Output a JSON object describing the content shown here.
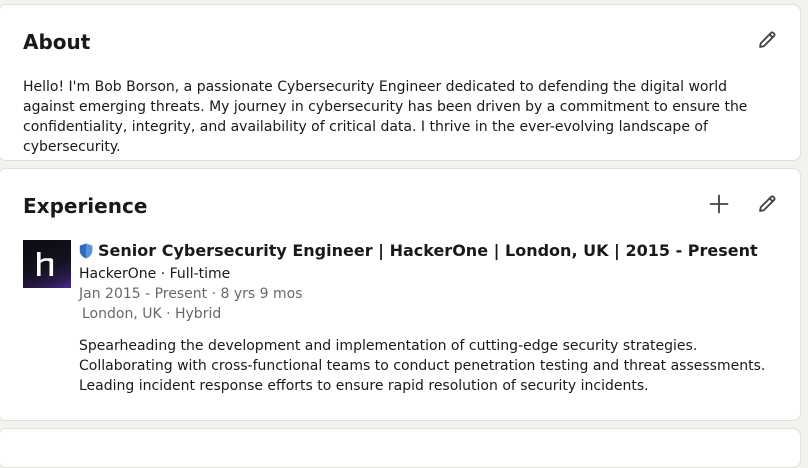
{
  "about": {
    "title": "About",
    "text": "Hello! I'm Bob Borson, a passionate Cybersecurity Engineer dedicated to defending the digital world against emerging threats. My journey in cybersecurity has been driven by a commitment to ensure the confidentiality, integrity, and availability of critical data. I thrive in the ever-evolving landscape of cybersecurity."
  },
  "experience": {
    "title": "Experience",
    "items": [
      {
        "title": "Senior Cybersecurity Engineer | HackerOne | London, UK | 2015 - Present",
        "company_line": "HackerOne · Full-time",
        "dates_line": "Jan 2015 - Present · 8 yrs 9 mos",
        "location_line": "London, UK · Hybrid",
        "description": [
          "Spearheading the development and implementation of cutting-edge security strategies.",
          "Collaborating with cross-functional teams to conduct penetration testing and threat assessments.",
          "Leading incident response efforts to ensure rapid resolution of security incidents."
        ],
        "logo_icon": "hackerone-logo-icon",
        "badge_icon": "shield-icon"
      }
    ]
  },
  "icons": {
    "edit": "pencil-icon",
    "add": "plus-icon"
  },
  "colors": {
    "page_bg": "#f4f2ee",
    "card_bg": "#ffffff",
    "badge_blue": "#2e6bb8"
  }
}
